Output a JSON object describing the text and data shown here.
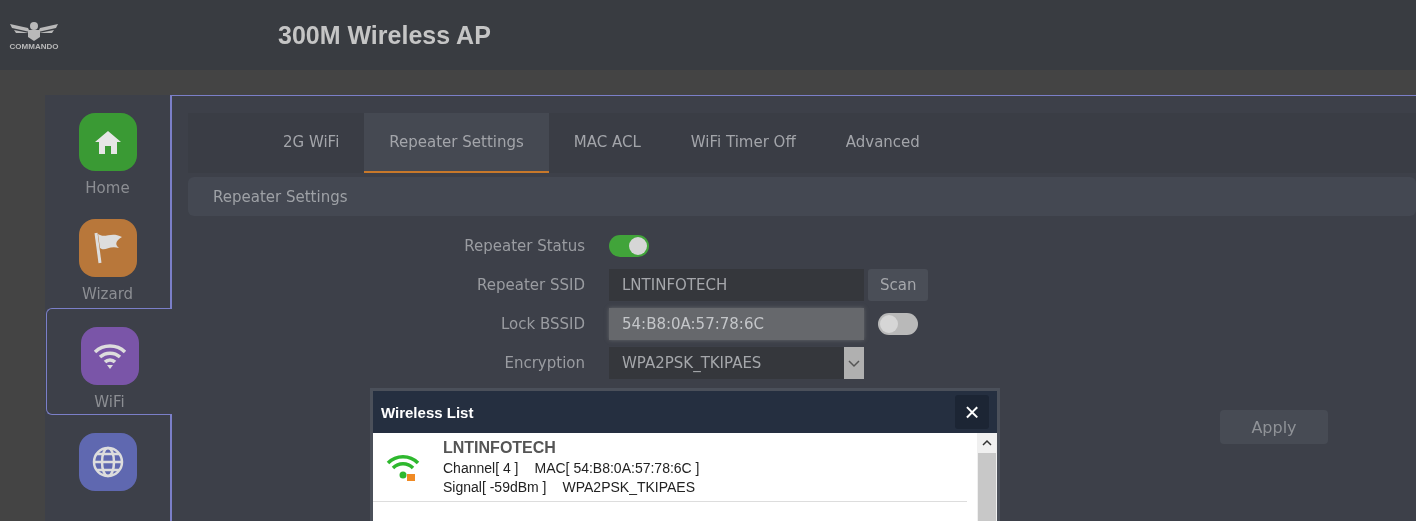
{
  "header": {
    "logo_text": "COMMANDO",
    "title": "300M Wireless AP"
  },
  "sidebar": {
    "items": [
      {
        "kind": "home",
        "label": "Home",
        "color": "#3a9a34",
        "selected": false
      },
      {
        "kind": "flag",
        "label": "Wizard",
        "color": "#b8773a",
        "selected": false
      },
      {
        "kind": "wifi",
        "label": "WiFi",
        "color": "#7a55a8",
        "selected": true
      },
      {
        "kind": "globe",
        "color": "#5f68b0",
        "selected": false
      }
    ]
  },
  "tabs": [
    {
      "label": "2G WiFi",
      "selected": false
    },
    {
      "label": "Repeater Settings",
      "selected": true
    },
    {
      "label": "MAC ACL",
      "selected": false
    },
    {
      "label": "WiFi Timer Off",
      "selected": false
    },
    {
      "label": "Advanced",
      "selected": false
    }
  ],
  "section_title": "Repeater Settings",
  "form": [
    {
      "kind": "toggle",
      "label": "Repeater Status",
      "on": true
    },
    {
      "kind": "text",
      "label": "Repeater SSID",
      "value": "LNTINFOTECH",
      "button": "Scan"
    },
    {
      "kind": "locked",
      "label": "Lock BSSID",
      "value": "54:B8:0A:57:78:6C",
      "on": false
    },
    {
      "kind": "select",
      "label": "Encryption",
      "value": "WPA2PSK_TKIPAES"
    }
  ],
  "apply_button": "Apply",
  "dialog": {
    "title": "Wireless List",
    "close": "×",
    "networks": [
      {
        "ssid": "LNTINFOTECH",
        "channel": "Channel[ 4 ]",
        "mac": "MAC[ 54:B8:0A:57:78:6C ]",
        "signal": "Signal[ -59dBm ]",
        "security": "WPA2PSK_TKIPAES"
      }
    ]
  }
}
